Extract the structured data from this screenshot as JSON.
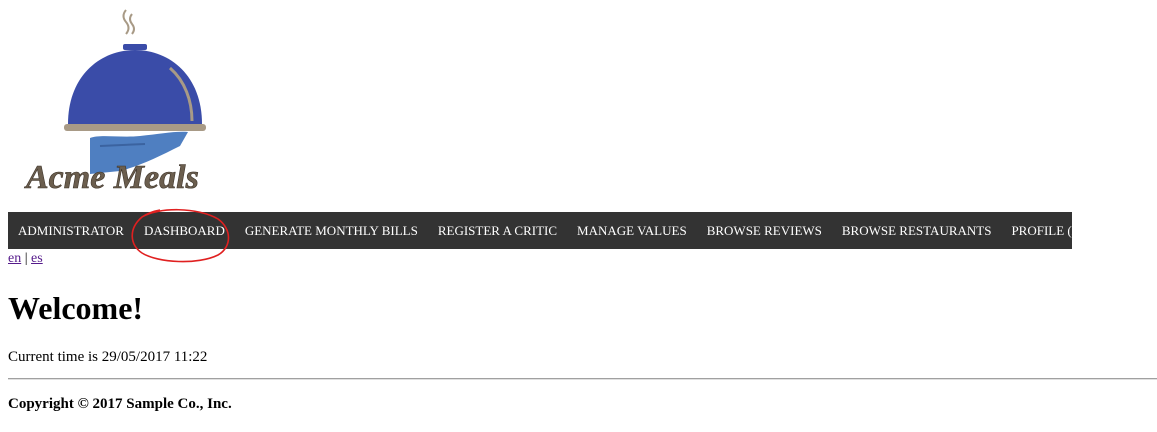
{
  "logo": {
    "text": "Acme Meals",
    "icon": "cloche-serving-hand-logo",
    "colors": {
      "cloche": "#3a4ca8",
      "hand": "#4f7fc1",
      "tray": "#a89a86",
      "text": "#6b5e4e"
    }
  },
  "nav": {
    "background": "#333333",
    "items": [
      {
        "label": "ADMINISTRATOR"
      },
      {
        "label": "DASHBOARD"
      },
      {
        "label": "GENERATE MONTHLY BILLS"
      },
      {
        "label": "REGISTER A CRITIC"
      },
      {
        "label": "MANAGE VALUES"
      },
      {
        "label": "BROWSE REVIEWS"
      },
      {
        "label": "BROWSE RESTAURANTS"
      },
      {
        "label": "PROFILE (ADMIN)"
      }
    ],
    "highlight_color": "#e02020"
  },
  "lang": {
    "en": "en",
    "separator": "|",
    "es": "es"
  },
  "main": {
    "title": "Welcome!",
    "time_text": "Current time is 29/05/2017 11:22"
  },
  "footer": {
    "copyright": "Copyright © 2017 Sample Co., Inc."
  }
}
